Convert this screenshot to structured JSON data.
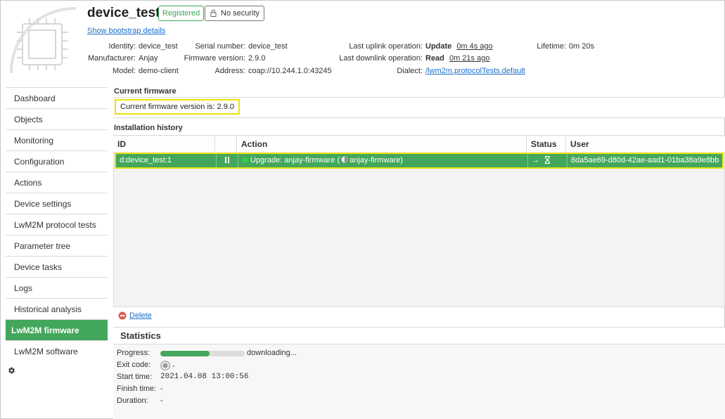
{
  "device": {
    "name": "device_test",
    "registered_badge": "Registered",
    "security_badge": "No security",
    "bootstrap_link": "Show bootstrap details"
  },
  "meta": {
    "identity_label": "Identity:",
    "identity": "device_test",
    "manufacturer_label": "Manufacturer:",
    "manufacturer": "Anjay",
    "model_label": "Model:",
    "model": "demo-client",
    "serial_label": "Serial number:",
    "serial": "device_test",
    "firmware_label": "Firmware version:",
    "firmware": "2.9.0",
    "address_label": "Address:",
    "address": "coap://10.244.1.0:43245",
    "uplink_label": "Last uplink operation:",
    "uplink_op": "Update",
    "uplink_time": "0m 4s ago",
    "downlink_label": "Last downlink operation:",
    "downlink_op": "Read",
    "downlink_time": "0m 21s ago",
    "dialect_label": "Dialect:",
    "dialect": "/lwm2m.protocolTests.default",
    "lifetime_label": "Lifetime:",
    "lifetime": "0m 20s"
  },
  "sidebar": {
    "items": [
      {
        "label": "Dashboard"
      },
      {
        "label": "Objects"
      },
      {
        "label": "Monitoring"
      },
      {
        "label": "Configuration"
      },
      {
        "label": "Actions"
      },
      {
        "label": "Device settings"
      },
      {
        "label": "LwM2M protocol tests"
      },
      {
        "label": "Parameter tree"
      },
      {
        "label": "Device tasks"
      },
      {
        "label": "Logs"
      },
      {
        "label": "Historical analysis"
      },
      {
        "label": "LwM2M firmware"
      },
      {
        "label": "LwM2M software"
      }
    ],
    "active_index": 11
  },
  "current_firmware": {
    "title": "Current firmware",
    "text": "Current firmware version is: 2.9.0"
  },
  "history": {
    "title": "Installation history",
    "columns": {
      "id": "ID",
      "action": "Action",
      "status": "Status",
      "user": "User"
    },
    "rows": [
      {
        "id": "d:device_test:1",
        "action": "Upgrade: anjay-firmware (",
        "action_pkg": "anjay-firmware)",
        "status_arrow": "→",
        "user": "8da5ae69-d80d-42ae-aad1-01ba38a9e8bb"
      }
    ]
  },
  "delete_label": "Delete",
  "statistics": {
    "title": "Statistics",
    "progress_label": "Progress:",
    "progress_fraction": 0.58,
    "progress_text": "downloading...",
    "exit_code_label": "Exit code:",
    "exit_code": "-",
    "start_label": "Start time:",
    "start_time": "2021.04.08 13:00:56",
    "finish_label": "Finish time:",
    "finish_time": "-",
    "duration_label": "Duration:",
    "duration": "-"
  },
  "colors": {
    "accent": "#43a75b",
    "highlight": "#ede010",
    "link": "#1a6fc9"
  }
}
